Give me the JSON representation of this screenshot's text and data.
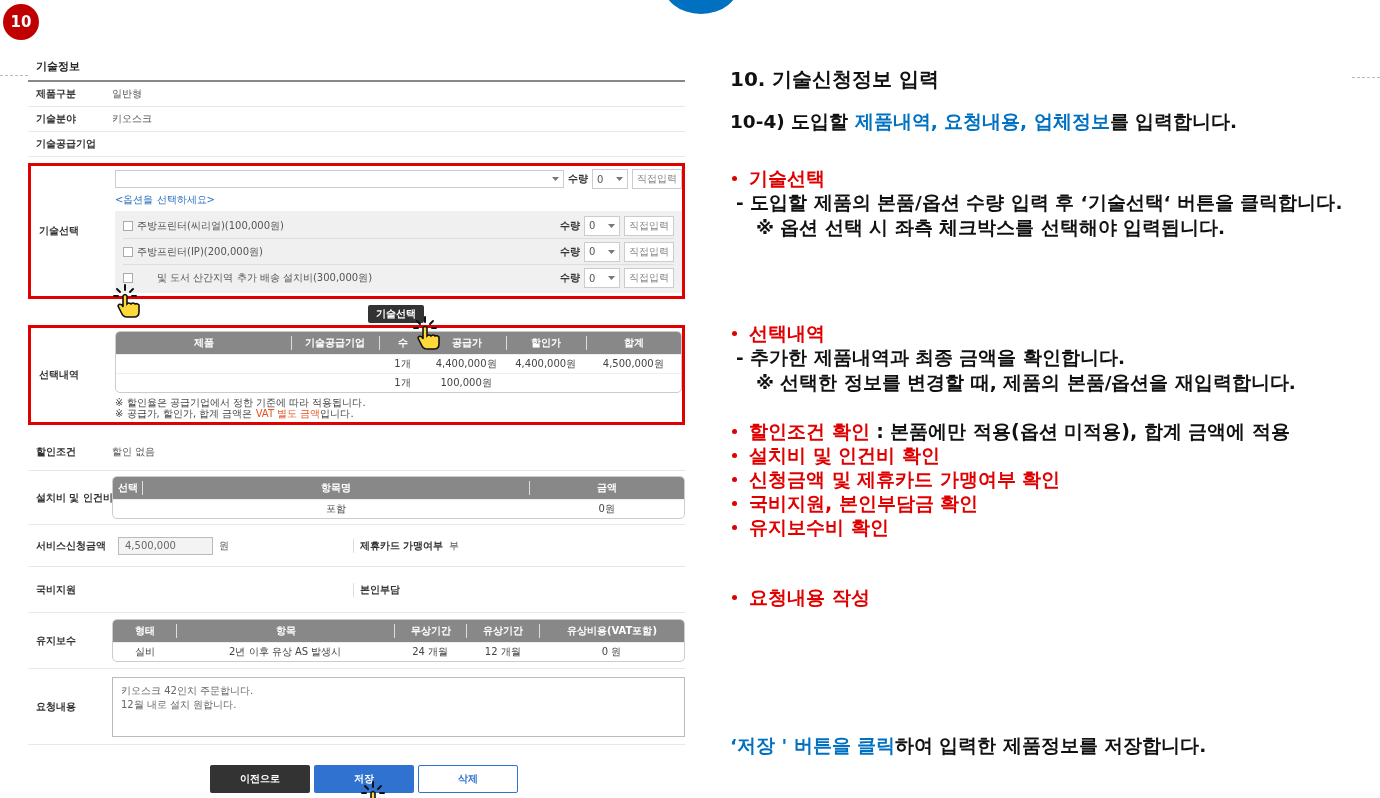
{
  "step_badge": "10",
  "form": {
    "title": "기술정보",
    "info_rows": [
      {
        "label": "제품구분",
        "value": "일반형"
      },
      {
        "label": "기술분야",
        "value": "키오스크"
      },
      {
        "label": "기술공급기업"
      }
    ],
    "tech_select": {
      "label": "기술선택",
      "highlighted": true,
      "quantity_label": "수량",
      "main_quantity": "0",
      "direct_button": "직접입력",
      "option_hint": "<옵션을 선택하세요>",
      "options": [
        {
          "name": "주방프린터(씨리얼)(100,000원)",
          "checked": false,
          "quantity_label": "수량",
          "quantity": "0",
          "direct_button": "직접입력"
        },
        {
          "name": "주방프린터(IP)(200,000원)",
          "checked": false,
          "quantity_label": "수량",
          "quantity": "0",
          "direct_button": "직접입력"
        },
        {
          "name": "및 도서 산간지역 추가 배송 설치비(300,000원)",
          "checked": false,
          "quantity_label": "수량",
          "quantity": "0",
          "direct_button": "직접입력"
        }
      ]
    },
    "select_button": "기술선택",
    "selection": {
      "label": "선택내역",
      "highlighted": true,
      "columns": [
        "제품",
        "기술공급기업",
        "수",
        "공급가",
        "할인가",
        "합계"
      ],
      "rows": [
        {
          "quantity": "1개",
          "supply": "4,400,000원",
          "discount": "4,400,000원",
          "total": "4,500,000원"
        },
        {
          "quantity": "1개",
          "supply": "100,000원"
        }
      ],
      "notes": [
        [
          {
            "text": "※ 할인율은 공급기업에서 정한 기준에 따라 적용됩니다."
          }
        ],
        [
          {
            "text": "※ 공급가, 할인가, 합계 금액은 "
          },
          {
            "text": "VAT 별도 금액",
            "accent": true
          },
          {
            "text": "입니다."
          }
        ]
      ]
    },
    "discount": {
      "label": "할인조건",
      "value": "할인 없음"
    },
    "setup_fee": {
      "label": "설치비 및 인건비",
      "columns": [
        "선택",
        "항목명",
        "금액"
      ],
      "rows": [
        {
          "item": "포함",
          "amount": "0원"
        }
      ]
    },
    "service_amount": {
      "label": "서비스신청금액",
      "value": "4,500,000",
      "unit": "원",
      "card_label": "제휴카드 가맹여부",
      "card_value": "부"
    },
    "support": {
      "label": "국비지원",
      "self_label": "본인부담"
    },
    "maintenance": {
      "label": "유지보수",
      "columns": [
        "형태",
        "항목",
        "무상기간",
        "유상기간",
        "유상비용(VAT포함)"
      ],
      "rows": [
        [
          "실비",
          "2년 이후 유상 AS 발생시",
          "24 개월",
          "12 개월",
          "0 원"
        ]
      ]
    },
    "request": {
      "label": "요청내용",
      "value": "키오스크 42인치 주문합니다.\n12월 내로 설치 원합니다."
    },
    "buttons": [
      {
        "label": "이전으로",
        "kind": "dark"
      },
      {
        "label": "저장",
        "kind": "primary"
      },
      {
        "label": "삭제",
        "kind": "outline"
      }
    ]
  },
  "guide": {
    "heading": "10. 기술신청정보 입력",
    "subheading": [
      {
        "text": "10-4) 도입할 "
      },
      {
        "text": "제품내역, 요청내용, 업체정보",
        "accent": true
      },
      {
        "text": "를 입력합니다."
      }
    ],
    "groups": [
      [
        {
          "title": "기술선택",
          "lines": [
            "- 도입할 제품의 본품/옵션 수량 입력 후 ‘기술선택‘ 버튼을 클릭합니다.",
            "※ 옵션 선택 시 좌측 체크박스를 선택해야 입력됩니다."
          ]
        }
      ],
      [
        {
          "title": "선택내역",
          "lines": [
            "- 추가한 제품내역과 최종 금액을 확인합니다.",
            "※ 선택한 정보를 변경할 때, 제품의 본품/옵션을 재입력합니다."
          ]
        }
      ],
      [
        {
          "title": "할인조건 확인",
          "rest": " : 본품에만 적용(옵션 미적용), 합계 금액에 적용"
        },
        {
          "title": "설치비 및 인건비 확인"
        },
        {
          "title": "신청금액 및 제휴카드 가맹여부 확인"
        },
        {
          "title": "국비지원, 본인부담금 확인"
        },
        {
          "title": "유지보수비 확인"
        }
      ],
      [
        {
          "title": "요청내용 작성"
        }
      ]
    ],
    "footer": [
      {
        "text": "‘저장 ' 버튼을 클릭",
        "accent": true
      },
      {
        "text": "하여 입력한 제품정보를 저장합니다."
      }
    ]
  }
}
